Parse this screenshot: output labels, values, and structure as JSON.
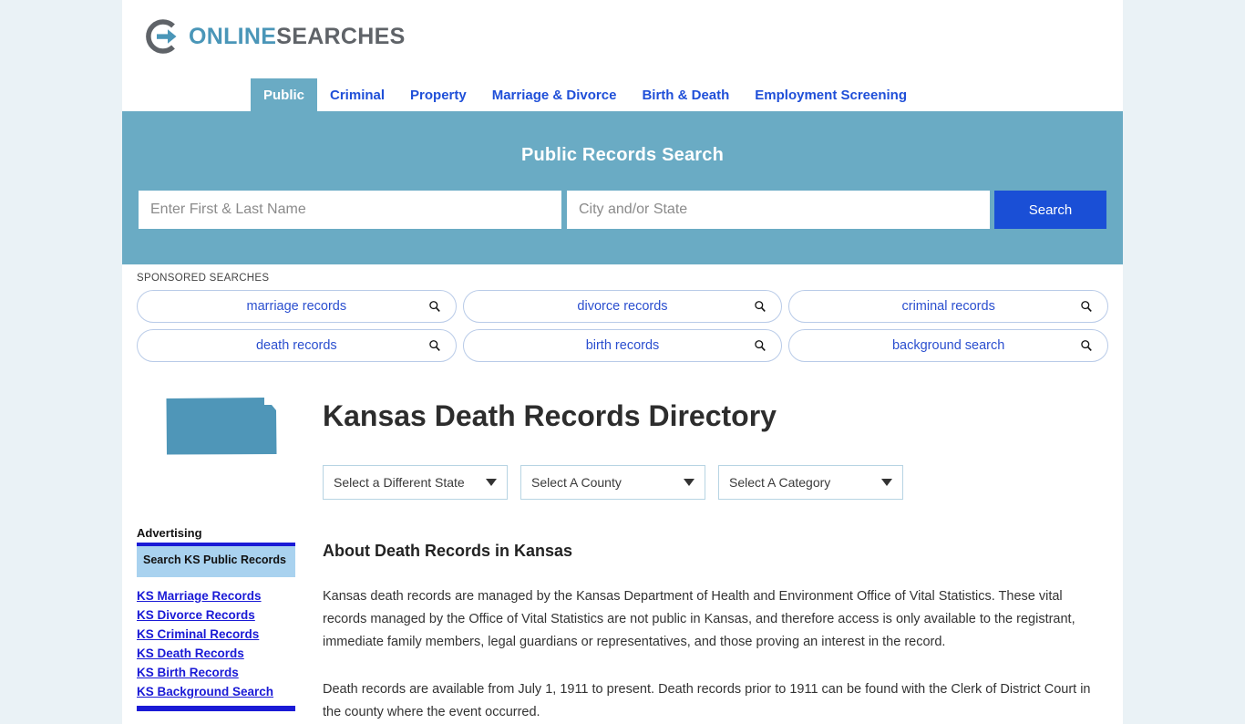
{
  "brand": {
    "logo_icon": "circle-arrow-logo-icon",
    "name_part1": "ONLINE",
    "name_part2": "SEARCHES",
    "accent_blue": "#4a96b8",
    "accent_gray": "#5f6368"
  },
  "nav": {
    "items": [
      {
        "label": "Public",
        "active": true
      },
      {
        "label": "Criminal",
        "active": false
      },
      {
        "label": "Property",
        "active": false
      },
      {
        "label": "Marriage & Divorce",
        "active": false
      },
      {
        "label": "Birth & Death",
        "active": false
      },
      {
        "label": "Employment Screening",
        "active": false
      }
    ],
    "active_bg": "#6aabc4",
    "link_color": "#1f4fd8"
  },
  "hero": {
    "title": "Public Records Search",
    "background": "#6aabc4",
    "name_placeholder": "Enter First & Last Name",
    "name_value": "",
    "location_placeholder": "City and/or State",
    "location_value": "",
    "search_label": "Search",
    "search_button_color": "#1a4fd6"
  },
  "sponsored": {
    "label": "SPONSORED SEARCHES",
    "icon": "search-icon",
    "pills": [
      "marriage records",
      "divorce records",
      "criminal records",
      "death records",
      "birth records",
      "background search"
    ]
  },
  "sidebar": {
    "state_icon": "kansas-state-shape-icon",
    "advertising_title": "Advertising",
    "ad_box_text": "Search KS Public Records",
    "links": [
      "KS Marriage Records",
      "KS Divorce Records",
      "KS Criminal Records",
      "KS Death Records",
      "KS Birth Records",
      "KS Background Search"
    ],
    "link_color": "#1a1ad6",
    "ad_box_bg": "#a9d2ef"
  },
  "main": {
    "page_title": "Kansas Death Records Directory",
    "selects": [
      {
        "name": "state",
        "value": "Select a Different State"
      },
      {
        "name": "county",
        "value": "Select A County"
      },
      {
        "name": "category",
        "value": "Select A Category"
      }
    ],
    "section_heading": "About Death Records in Kansas",
    "paragraph_1": "Kansas death records are managed by the Kansas Department of Health and Environment Office of Vital Statistics. These vital records managed by the Office of Vital Statistics are not public in Kansas, and therefore access is only available to the registrant, immediate family members, legal guardians or representatives, and those proving an interest in the record.",
    "paragraph_2": "Death records are available from July 1, 1911 to present. Death records prior to 1911 can be found with the Clerk of District Court in the county where the event occurred."
  }
}
